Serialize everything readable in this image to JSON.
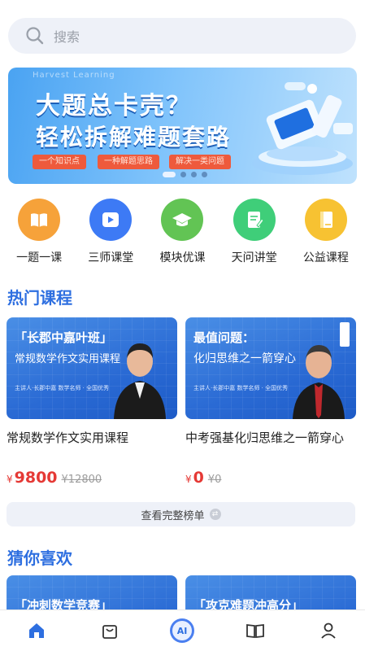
{
  "search": {
    "placeholder": "搜索"
  },
  "banner": {
    "faint_text": "Harvest Learning",
    "title_line1": "大题总卡壳？",
    "title_line2": "轻松拆解难题套路",
    "tags": [
      "一个知识点",
      "一种解题思路",
      "解决一类问题"
    ],
    "active_dot": 0,
    "dot_count": 4
  },
  "categories": [
    {
      "label": "一题一课",
      "icon": "book-icon",
      "color": "#f6a23a"
    },
    {
      "label": "三师课堂",
      "icon": "play-icon",
      "color": "#3d7af5"
    },
    {
      "label": "模块优课",
      "icon": "graduation-cap-icon",
      "color": "#62c454"
    },
    {
      "label": "天问讲堂",
      "icon": "document-edit-icon",
      "color": "#3fce79"
    },
    {
      "label": "公益课程",
      "icon": "notebook-icon",
      "color": "#f7c232"
    }
  ],
  "hot": {
    "title": "热门课程",
    "courses": [
      {
        "thumb_line1": "「长郡中嘉叶班」",
        "thumb_line2": "常规数学作文实用课程",
        "thumb_line3": "主讲人·长郡中嘉 数学名师 · 全国优秀",
        "title": "常规数学作文实用课程",
        "currency": "¥",
        "price": "9800",
        "original_price": "¥12800"
      },
      {
        "thumb_line1": "最值问题：",
        "thumb_line2": "化归思维之一箭穿心",
        "thumb_line3": "主讲人·长郡中嘉 数学名师 · 全国优秀",
        "title": "中考强基化归思维之一箭穿心",
        "currency": "¥",
        "price": "0",
        "original_price": "¥0"
      }
    ],
    "more_label": "查看完整榜单"
  },
  "guess": {
    "title": "猜你喜欢",
    "courses": [
      {
        "thumb_line1": "「冲刺数学竞赛」"
      },
      {
        "thumb_line1": "「攻克难题冲高分」"
      }
    ]
  },
  "tabbar": [
    {
      "name": "home",
      "icon": "home-icon",
      "active": true
    },
    {
      "name": "courses",
      "icon": "bag-icon",
      "active": false
    },
    {
      "name": "ai",
      "icon": "ai-icon",
      "active": false
    },
    {
      "name": "study",
      "icon": "open-book-icon",
      "active": false
    },
    {
      "name": "me",
      "icon": "user-icon",
      "active": false
    }
  ],
  "colors": {
    "accent": "#2e6fe0",
    "price": "#e53935",
    "search_bg": "#eef1f8"
  }
}
